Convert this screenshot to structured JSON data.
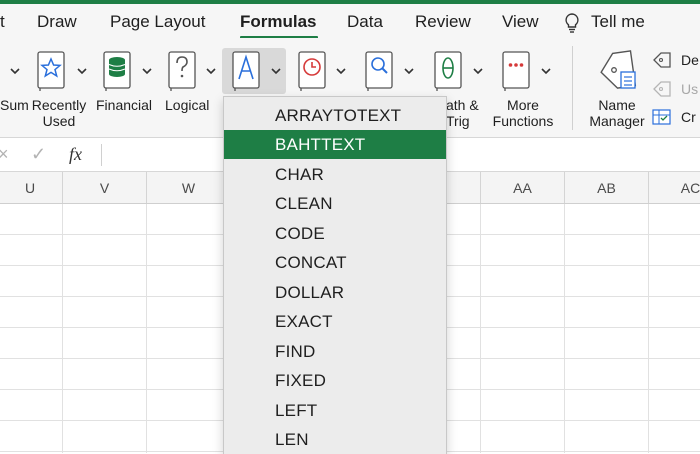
{
  "menu": {
    "tabs": [
      {
        "id": "insert",
        "label": "t"
      },
      {
        "id": "draw",
        "label": "Draw"
      },
      {
        "id": "page-layout",
        "label": "Page Layout"
      },
      {
        "id": "formulas",
        "label": "Formulas",
        "active": true
      },
      {
        "id": "data",
        "label": "Data"
      },
      {
        "id": "review",
        "label": "Review"
      },
      {
        "id": "view",
        "label": "View"
      },
      {
        "id": "tell-me",
        "label": "Tell me"
      }
    ]
  },
  "ribbon": {
    "autosum_label": "Sum",
    "recently_used_label_1": "Recently",
    "recently_used_label_2": "Used",
    "financial_label": "Financial",
    "logical_label": "Logical",
    "math_label_1": "ath &",
    "math_label_2": "Trig",
    "more_functions_label_1": "More",
    "more_functions_label_2": "Functions",
    "name_manager_label_1": "Name",
    "name_manager_label_2": "Manager",
    "define_name_label": "De",
    "use_in_formula_label": "Us",
    "create_from_selection_label": "Cr"
  },
  "formula_bar": {
    "cancel_glyph": "×",
    "enter_glyph": "✓",
    "fx_label": "fx"
  },
  "columns": [
    "U",
    "V",
    "W",
    "AA",
    "AB",
    "AC"
  ],
  "dropdown": {
    "items": [
      "ARRAYTOTEXT",
      "BAHTTEXT",
      "CHAR",
      "CLEAN",
      "CODE",
      "CONCAT",
      "DOLLAR",
      "EXACT",
      "FIND",
      "FIXED",
      "LEFT",
      "LEN"
    ],
    "selected": "BAHTTEXT"
  },
  "colors": {
    "accent": "#1e7e45",
    "ribbon_bg": "#f6f6f6",
    "dropdown_bg": "#ececec",
    "icon_blue": "#2a6fdb",
    "icon_green": "#1e7e45",
    "icon_red": "#d63a3a"
  }
}
